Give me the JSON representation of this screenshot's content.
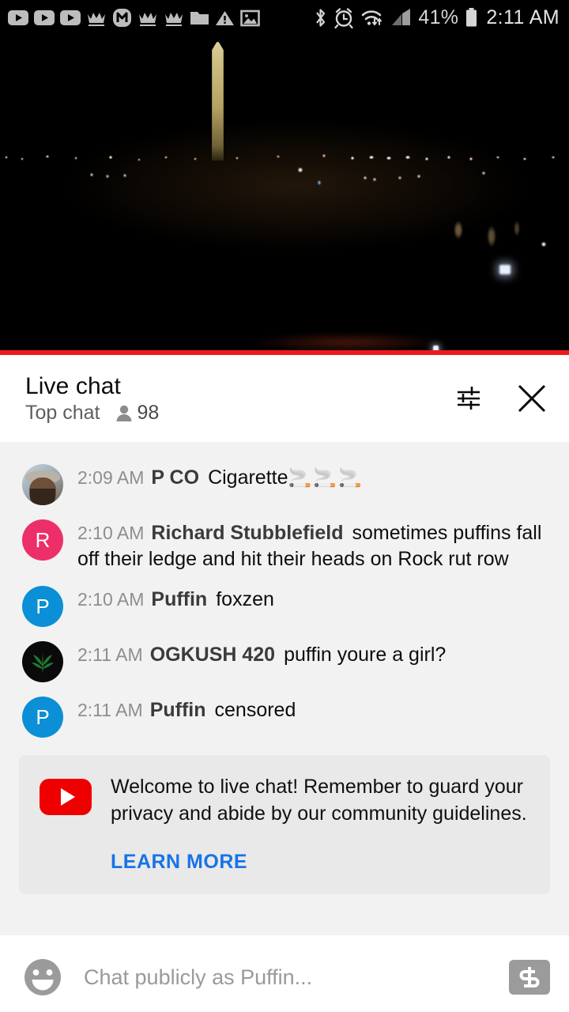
{
  "status_bar": {
    "left_icons": [
      {
        "name": "youtube-play-icon-1",
        "glyph": "▶"
      },
      {
        "name": "youtube-play-icon-2",
        "glyph": "▶"
      },
      {
        "name": "youtube-play-icon-3",
        "glyph": "▶"
      },
      {
        "name": "crown-icon-1",
        "glyph": "♔"
      },
      {
        "name": "monogram-m-icon",
        "glyph": "M"
      },
      {
        "name": "crown-icon-2",
        "glyph": "♔"
      },
      {
        "name": "crown-icon-3",
        "glyph": "♔"
      },
      {
        "name": "folder-icon",
        "glyph": "📁"
      },
      {
        "name": "warning-icon",
        "glyph": "⚠"
      },
      {
        "name": "image-icon",
        "glyph": "🖼"
      }
    ],
    "right_icons": [
      {
        "name": "bluetooth-icon"
      },
      {
        "name": "alarm-clock-icon"
      },
      {
        "name": "wifi-icon"
      },
      {
        "name": "signal-icon"
      }
    ],
    "battery_percent": "41%",
    "time": "2:11 AM"
  },
  "video": {
    "progress_color": "#ed1a1a",
    "progress_percent": 100
  },
  "chat_header": {
    "title": "Live chat",
    "subtitle": "Top chat",
    "viewer_count": "98",
    "settings_icon": "tune-sliders-icon",
    "close_icon": "close-x-icon"
  },
  "messages": [
    {
      "time": "2:09 AM",
      "author": "P CO",
      "text": "Cigarette",
      "emoji": "🚬🚬🚬",
      "avatar": {
        "type": "photo",
        "name": "avatar-p-co"
      }
    },
    {
      "time": "2:10 AM",
      "author": "Richard Stubblefield",
      "text": "sometimes puffins fall off their ledge and hit their heads on Rock rut row",
      "emoji": "",
      "avatar": {
        "type": "letter",
        "letter": "R",
        "color": "#ed2f69",
        "name": "avatar-richard-stubblefield"
      }
    },
    {
      "time": "2:10 AM",
      "author": "Puffin",
      "text": "foxzen",
      "emoji": "",
      "avatar": {
        "type": "letter",
        "letter": "P",
        "color": "#0b8fd6",
        "name": "avatar-puffin"
      }
    },
    {
      "time": "2:11 AM",
      "author": "OGKUSH 420",
      "text": "puffin youre a girl?",
      "emoji": "",
      "avatar": {
        "type": "leaf",
        "glyph": "🍁",
        "name": "avatar-ogkush-420"
      }
    },
    {
      "time": "2:11 AM",
      "author": "Puffin",
      "text": "censored",
      "emoji": "",
      "avatar": {
        "type": "letter",
        "letter": "P",
        "color": "#0b8fd6",
        "name": "avatar-puffin"
      }
    }
  ],
  "notice": {
    "text": "Welcome to live chat! Remember to guard your privacy and abide by our community guidelines.",
    "learn_more_label": "LEARN MORE",
    "link_color": "#1873e8",
    "logo_name": "youtube-logo-icon",
    "logo_color": "#ef0000"
  },
  "input_bar": {
    "emoji_icon": "emoji-smiley-icon",
    "placeholder": "Chat publicly as Puffin...",
    "superchat_icon": "dollar-superchat-icon",
    "value": ""
  }
}
